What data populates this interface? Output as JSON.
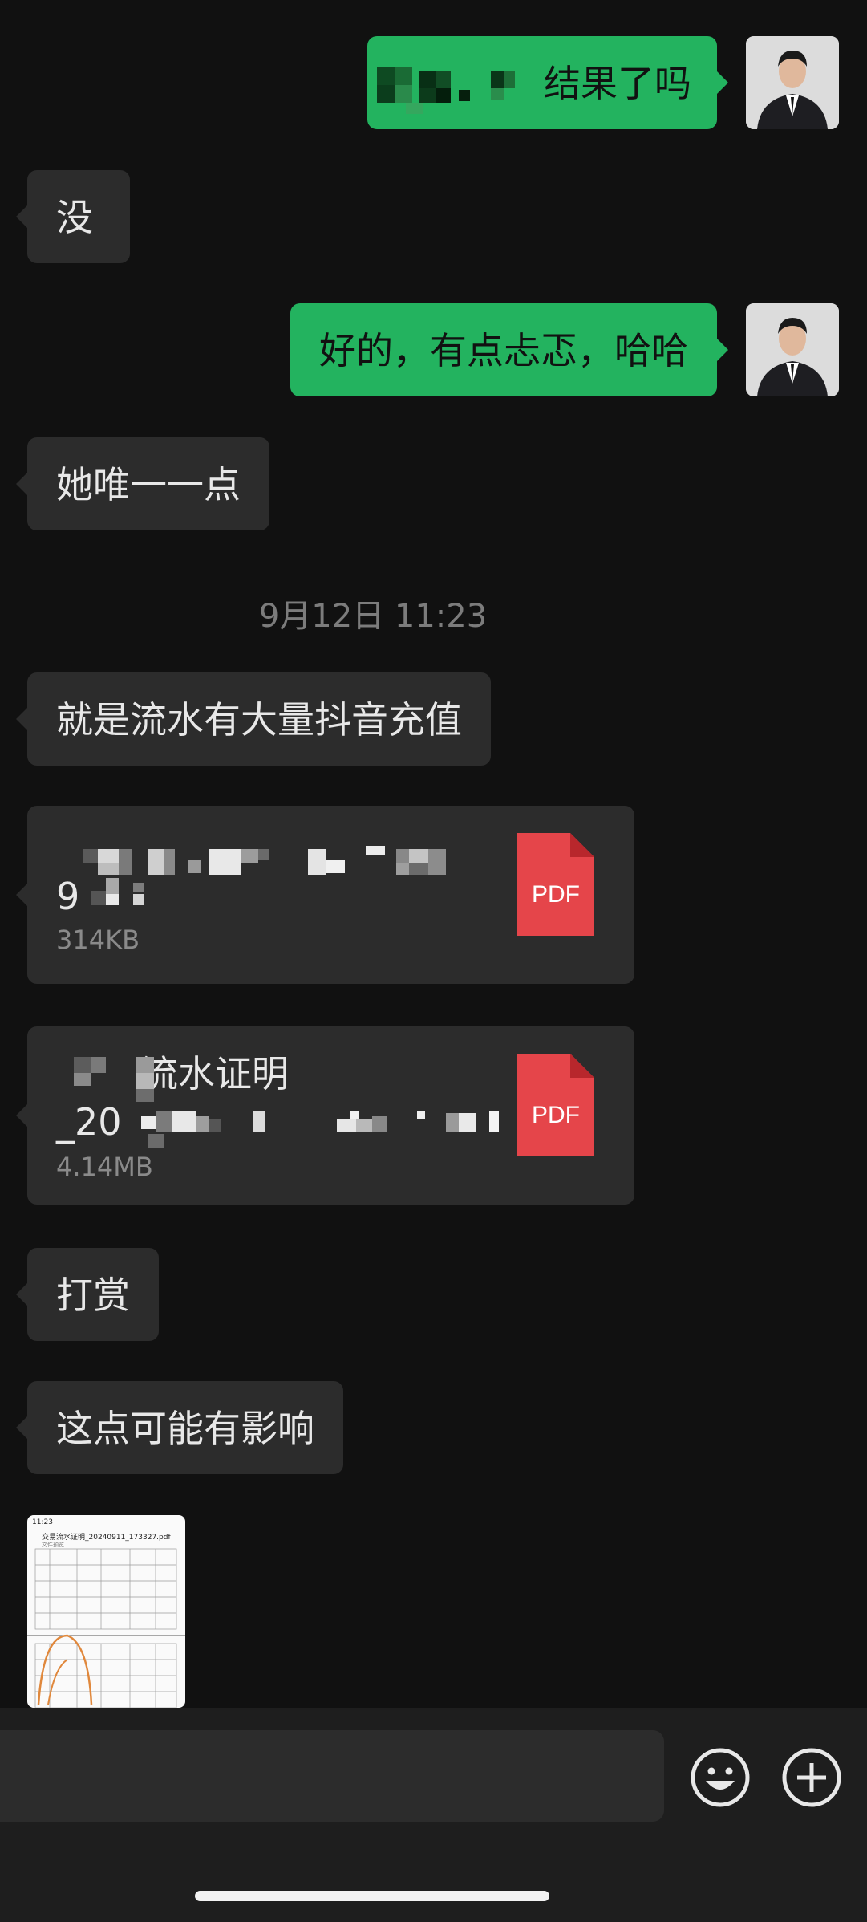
{
  "messages": {
    "m1_text": "结果了吗",
    "m2_text": "没",
    "m3_text": "好的，有点忐忑，哈哈",
    "m4_text": "她唯一一点",
    "timestamp": "9月12日 11:23",
    "m5_text": "就是流水有大量抖音充值",
    "file1": {
      "name_prefix": "9",
      "size": "314KB",
      "type": "PDF"
    },
    "file2": {
      "name_line1": "流水证明",
      "name_line2_prefix": "_20",
      "size": "4.14MB",
      "type": "PDF"
    },
    "m6_text": "打赏",
    "m7_text": "这点可能有影响",
    "thumb": {
      "time": "11:23",
      "title": "交易流水证明_20240911_173327.pdf",
      "subtitle": "文件预览"
    }
  },
  "icons": {
    "emoji": "emoji-icon",
    "plus": "plus-icon",
    "pdf": "pdf-icon"
  },
  "colors": {
    "outgoing_bubble": "#23b35f",
    "incoming_bubble": "#2c2c2c",
    "pdf_red": "#e5454a",
    "background": "#111111"
  }
}
